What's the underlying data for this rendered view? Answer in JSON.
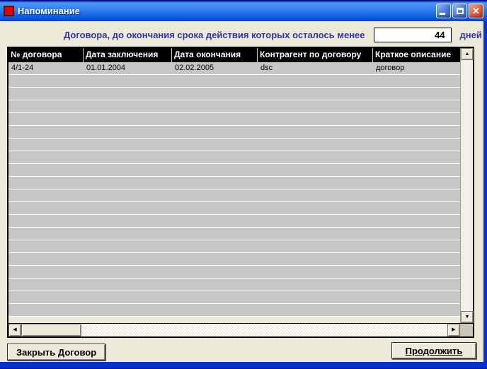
{
  "window": {
    "title": "Напоминание"
  },
  "filter": {
    "label": "Договора, до окончания срока действия которых осталось менее",
    "value": "44",
    "unit": "дней"
  },
  "table": {
    "columns": [
      "№ договора",
      "Дата заключения",
      "Дата окончания",
      "Контрагент по договору",
      "Краткое описание"
    ],
    "rows": [
      [
        "4/1-24",
        "01.01.2004",
        "02.02.2005",
        "dsc",
        "договор"
      ]
    ],
    "empty_row_count": 19
  },
  "actions": {
    "close_contract": "Закрыть Договор",
    "continue": "Продолжить"
  },
  "icons": {
    "close": "✕",
    "scroll_up": "▲",
    "scroll_down": "▼",
    "scroll_left": "◀",
    "scroll_right": "▶"
  },
  "colors": {
    "titlebar_blue": "#0855DD",
    "window_border": "#0831D9",
    "background": "#ECE9D8",
    "row_gray": "#C6C6C6",
    "header_bg": "#000000",
    "header_fg": "#FFFFFF",
    "label_blue": "#3333A6",
    "app_icon_red": "#E60000"
  }
}
